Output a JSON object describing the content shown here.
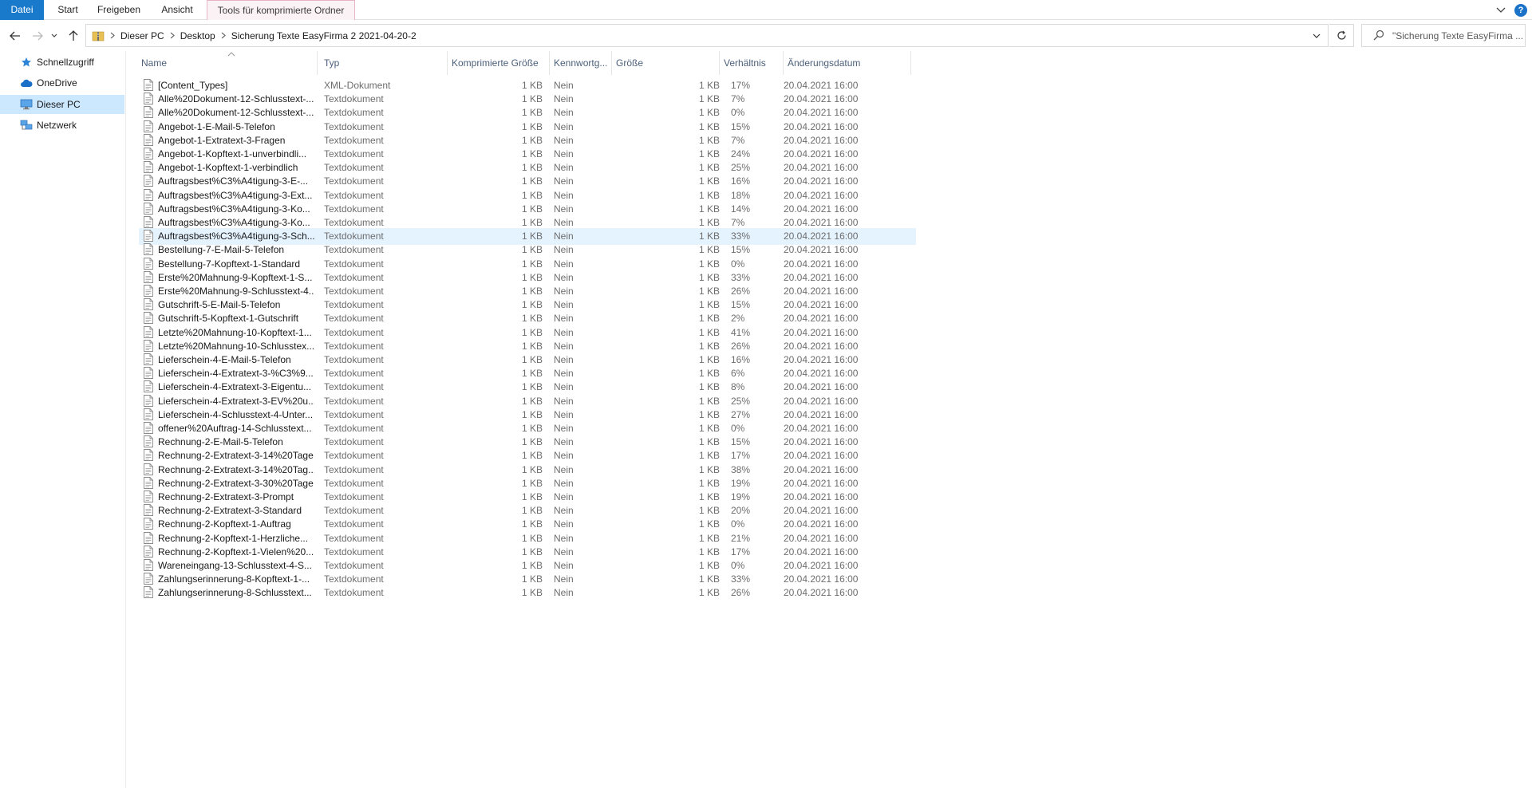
{
  "ribbon": {
    "tabs": [
      "Datei",
      "Start",
      "Freigeben",
      "Ansicht",
      "Tools für komprimierte Ordner"
    ],
    "help_label": "?"
  },
  "address": {
    "crumbs": [
      "Dieser PC",
      "Desktop",
      "Sicherung Texte EasyFirma 2 2021-04-20-2"
    ]
  },
  "search": {
    "placeholder": "\"Sicherung Texte EasyFirma ..."
  },
  "nav_pane": {
    "items": [
      {
        "label": "Schnellzugriff",
        "icon": "star-icon"
      },
      {
        "label": "OneDrive",
        "icon": "cloud-icon"
      },
      {
        "label": "Dieser PC",
        "icon": "computer-icon",
        "selected": true
      },
      {
        "label": "Netzwerk",
        "icon": "network-icon"
      }
    ]
  },
  "columns": [
    "Name",
    "Typ",
    "Komprimierte Größe",
    "Kennwortg...",
    "Größe",
    "Verhältnis",
    "Änderungsdatum"
  ],
  "files": [
    {
      "name": "[Content_Types]",
      "type": "XML-Dokument",
      "comp": "1 KB",
      "pwd": "Nein",
      "size": "1 KB",
      "ratio": "17%",
      "date": "20.04.2021 16:00"
    },
    {
      "name": "Alle%20Dokument-12-Schlusstext-...",
      "type": "Textdokument",
      "comp": "1 KB",
      "pwd": "Nein",
      "size": "1 KB",
      "ratio": "7%",
      "date": "20.04.2021 16:00"
    },
    {
      "name": "Alle%20Dokument-12-Schlusstext-...",
      "type": "Textdokument",
      "comp": "1 KB",
      "pwd": "Nein",
      "size": "1 KB",
      "ratio": "0%",
      "date": "20.04.2021 16:00"
    },
    {
      "name": "Angebot-1-E-Mail-5-Telefon",
      "type": "Textdokument",
      "comp": "1 KB",
      "pwd": "Nein",
      "size": "1 KB",
      "ratio": "15%",
      "date": "20.04.2021 16:00"
    },
    {
      "name": "Angebot-1-Extratext-3-Fragen",
      "type": "Textdokument",
      "comp": "1 KB",
      "pwd": "Nein",
      "size": "1 KB",
      "ratio": "7%",
      "date": "20.04.2021 16:00"
    },
    {
      "name": "Angebot-1-Kopftext-1-unverbindli...",
      "type": "Textdokument",
      "comp": "1 KB",
      "pwd": "Nein",
      "size": "1 KB",
      "ratio": "24%",
      "date": "20.04.2021 16:00"
    },
    {
      "name": "Angebot-1-Kopftext-1-verbindlich",
      "type": "Textdokument",
      "comp": "1 KB",
      "pwd": "Nein",
      "size": "1 KB",
      "ratio": "25%",
      "date": "20.04.2021 16:00"
    },
    {
      "name": "Auftragsbest%C3%A4tigung-3-E-...",
      "type": "Textdokument",
      "comp": "1 KB",
      "pwd": "Nein",
      "size": "1 KB",
      "ratio": "16%",
      "date": "20.04.2021 16:00"
    },
    {
      "name": "Auftragsbest%C3%A4tigung-3-Ext...",
      "type": "Textdokument",
      "comp": "1 KB",
      "pwd": "Nein",
      "size": "1 KB",
      "ratio": "18%",
      "date": "20.04.2021 16:00"
    },
    {
      "name": "Auftragsbest%C3%A4tigung-3-Ko...",
      "type": "Textdokument",
      "comp": "1 KB",
      "pwd": "Nein",
      "size": "1 KB",
      "ratio": "14%",
      "date": "20.04.2021 16:00"
    },
    {
      "name": "Auftragsbest%C3%A4tigung-3-Ko...",
      "type": "Textdokument",
      "comp": "1 KB",
      "pwd": "Nein",
      "size": "1 KB",
      "ratio": "7%",
      "date": "20.04.2021 16:00"
    },
    {
      "name": "Auftragsbest%C3%A4tigung-3-Sch...",
      "type": "Textdokument",
      "comp": "1 KB",
      "pwd": "Nein",
      "size": "1 KB",
      "ratio": "33%",
      "date": "20.04.2021 16:00",
      "highlight": true
    },
    {
      "name": "Bestellung-7-E-Mail-5-Telefon",
      "type": "Textdokument",
      "comp": "1 KB",
      "pwd": "Nein",
      "size": "1 KB",
      "ratio": "15%",
      "date": "20.04.2021 16:00"
    },
    {
      "name": "Bestellung-7-Kopftext-1-Standard",
      "type": "Textdokument",
      "comp": "1 KB",
      "pwd": "Nein",
      "size": "1 KB",
      "ratio": "0%",
      "date": "20.04.2021 16:00"
    },
    {
      "name": "Erste%20Mahnung-9-Kopftext-1-S...",
      "type": "Textdokument",
      "comp": "1 KB",
      "pwd": "Nein",
      "size": "1 KB",
      "ratio": "33%",
      "date": "20.04.2021 16:00"
    },
    {
      "name": "Erste%20Mahnung-9-Schlusstext-4...",
      "type": "Textdokument",
      "comp": "1 KB",
      "pwd": "Nein",
      "size": "1 KB",
      "ratio": "26%",
      "date": "20.04.2021 16:00"
    },
    {
      "name": "Gutschrift-5-E-Mail-5-Telefon",
      "type": "Textdokument",
      "comp": "1 KB",
      "pwd": "Nein",
      "size": "1 KB",
      "ratio": "15%",
      "date": "20.04.2021 16:00"
    },
    {
      "name": "Gutschrift-5-Kopftext-1-Gutschrift",
      "type": "Textdokument",
      "comp": "1 KB",
      "pwd": "Nein",
      "size": "1 KB",
      "ratio": "2%",
      "date": "20.04.2021 16:00"
    },
    {
      "name": "Letzte%20Mahnung-10-Kopftext-1...",
      "type": "Textdokument",
      "comp": "1 KB",
      "pwd": "Nein",
      "size": "1 KB",
      "ratio": "41%",
      "date": "20.04.2021 16:00"
    },
    {
      "name": "Letzte%20Mahnung-10-Schlusstex...",
      "type": "Textdokument",
      "comp": "1 KB",
      "pwd": "Nein",
      "size": "1 KB",
      "ratio": "26%",
      "date": "20.04.2021 16:00"
    },
    {
      "name": "Lieferschein-4-E-Mail-5-Telefon",
      "type": "Textdokument",
      "comp": "1 KB",
      "pwd": "Nein",
      "size": "1 KB",
      "ratio": "16%",
      "date": "20.04.2021 16:00"
    },
    {
      "name": "Lieferschein-4-Extratext-3-%C3%9...",
      "type": "Textdokument",
      "comp": "1 KB",
      "pwd": "Nein",
      "size": "1 KB",
      "ratio": "6%",
      "date": "20.04.2021 16:00"
    },
    {
      "name": "Lieferschein-4-Extratext-3-Eigentu...",
      "type": "Textdokument",
      "comp": "1 KB",
      "pwd": "Nein",
      "size": "1 KB",
      "ratio": "8%",
      "date": "20.04.2021 16:00"
    },
    {
      "name": "Lieferschein-4-Extratext-3-EV%20u...",
      "type": "Textdokument",
      "comp": "1 KB",
      "pwd": "Nein",
      "size": "1 KB",
      "ratio": "25%",
      "date": "20.04.2021 16:00"
    },
    {
      "name": "Lieferschein-4-Schlusstext-4-Unter...",
      "type": "Textdokument",
      "comp": "1 KB",
      "pwd": "Nein",
      "size": "1 KB",
      "ratio": "27%",
      "date": "20.04.2021 16:00"
    },
    {
      "name": "offener%20Auftrag-14-Schlusstext...",
      "type": "Textdokument",
      "comp": "1 KB",
      "pwd": "Nein",
      "size": "1 KB",
      "ratio": "0%",
      "date": "20.04.2021 16:00"
    },
    {
      "name": "Rechnung-2-E-Mail-5-Telefon",
      "type": "Textdokument",
      "comp": "1 KB",
      "pwd": "Nein",
      "size": "1 KB",
      "ratio": "15%",
      "date": "20.04.2021 16:00"
    },
    {
      "name": "Rechnung-2-Extratext-3-14%20Tage",
      "type": "Textdokument",
      "comp": "1 KB",
      "pwd": "Nein",
      "size": "1 KB",
      "ratio": "17%",
      "date": "20.04.2021 16:00"
    },
    {
      "name": "Rechnung-2-Extratext-3-14%20Tag...",
      "type": "Textdokument",
      "comp": "1 KB",
      "pwd": "Nein",
      "size": "1 KB",
      "ratio": "38%",
      "date": "20.04.2021 16:00"
    },
    {
      "name": "Rechnung-2-Extratext-3-30%20Tage",
      "type": "Textdokument",
      "comp": "1 KB",
      "pwd": "Nein",
      "size": "1 KB",
      "ratio": "19%",
      "date": "20.04.2021 16:00"
    },
    {
      "name": "Rechnung-2-Extratext-3-Prompt",
      "type": "Textdokument",
      "comp": "1 KB",
      "pwd": "Nein",
      "size": "1 KB",
      "ratio": "19%",
      "date": "20.04.2021 16:00"
    },
    {
      "name": "Rechnung-2-Extratext-3-Standard",
      "type": "Textdokument",
      "comp": "1 KB",
      "pwd": "Nein",
      "size": "1 KB",
      "ratio": "20%",
      "date": "20.04.2021 16:00"
    },
    {
      "name": "Rechnung-2-Kopftext-1-Auftrag",
      "type": "Textdokument",
      "comp": "1 KB",
      "pwd": "Nein",
      "size": "1 KB",
      "ratio": "0%",
      "date": "20.04.2021 16:00"
    },
    {
      "name": "Rechnung-2-Kopftext-1-Herzliche...",
      "type": "Textdokument",
      "comp": "1 KB",
      "pwd": "Nein",
      "size": "1 KB",
      "ratio": "21%",
      "date": "20.04.2021 16:00"
    },
    {
      "name": "Rechnung-2-Kopftext-1-Vielen%20...",
      "type": "Textdokument",
      "comp": "1 KB",
      "pwd": "Nein",
      "size": "1 KB",
      "ratio": "17%",
      "date": "20.04.2021 16:00"
    },
    {
      "name": "Wareneingang-13-Schlusstext-4-S...",
      "type": "Textdokument",
      "comp": "1 KB",
      "pwd": "Nein",
      "size": "1 KB",
      "ratio": "0%",
      "date": "20.04.2021 16:00"
    },
    {
      "name": "Zahlungserinnerung-8-Kopftext-1-...",
      "type": "Textdokument",
      "comp": "1 KB",
      "pwd": "Nein",
      "size": "1 KB",
      "ratio": "33%",
      "date": "20.04.2021 16:00"
    },
    {
      "name": "Zahlungserinnerung-8-Schlusstext...",
      "type": "Textdokument",
      "comp": "1 KB",
      "pwd": "Nein",
      "size": "1 KB",
      "ratio": "26%",
      "date": "20.04.2021 16:00"
    }
  ]
}
